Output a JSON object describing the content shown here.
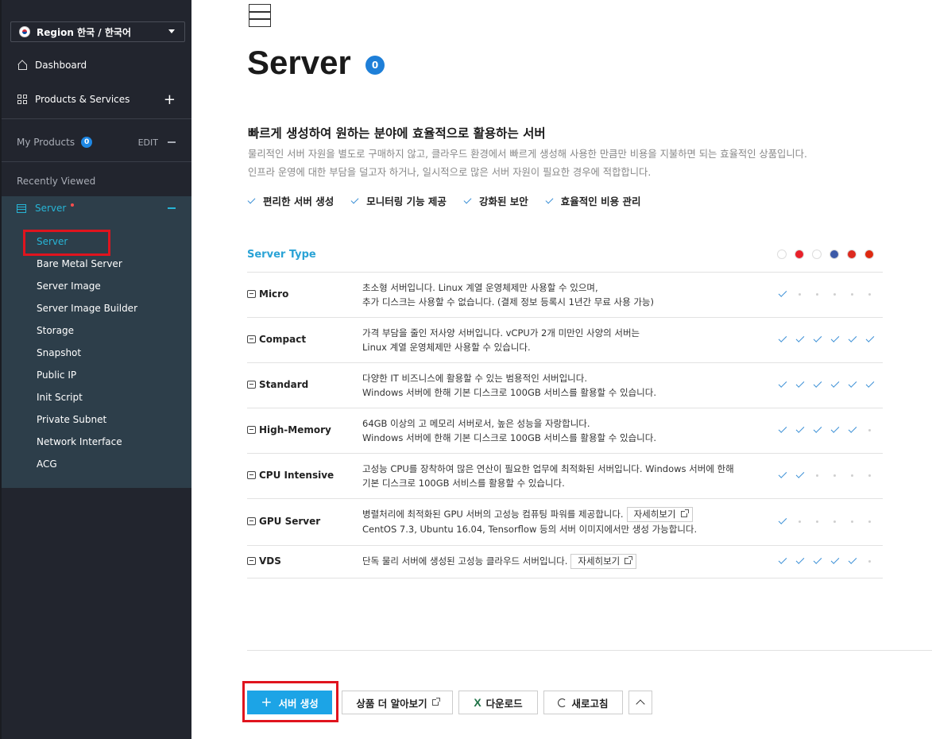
{
  "sidebar": {
    "region_label": "Region 한국 / 한국어",
    "dashboard": "Dashboard",
    "products_services": "Products & Services",
    "my_products": "My Products",
    "my_products_count": "0",
    "edit": "EDIT",
    "recently_viewed": "Recently Viewed",
    "group": "Server",
    "items": [
      "Server",
      "Bare Metal Server",
      "Server Image",
      "Server Image Builder",
      "Storage",
      "Snapshot",
      "Public IP",
      "Init Script",
      "Private Subnet",
      "Network Interface",
      "ACG"
    ],
    "accent": "#27b5d6"
  },
  "main": {
    "title": "Server",
    "count": "0",
    "headline": "빠르게 생성하여 원하는 분야에 효율적으로 활용하는 서버",
    "desc1": "물리적인 서버 자원을 별도로 구매하지 않고, 클라우드 환경에서 빠르게 생성해 사용한 만큼만 비용을 지불하면 되는 효율적인 상품입니다.",
    "desc2": "인프라 운영에 대한 부담을 덜고자 하거나, 일시적으로 많은 서버 자원이 필요한 경우에 적합합니다.",
    "features": [
      "편리한 서버 생성",
      "모니터링 기능 제공",
      "강화된 보안",
      "효율적인 비용 관리"
    ],
    "server_type_header": "Server Type",
    "types": [
      {
        "name": "Micro",
        "line1": "초소형 서버입니다. Linux 계열 운영체제만 사용할 수 있으며,",
        "line2": "추가 디스크는 사용할 수 없습니다. (결제 정보 등록시 1년간 무료 사용 가능)",
        "avail": [
          1,
          0,
          0,
          0,
          0,
          0
        ]
      },
      {
        "name": "Compact",
        "line1": "가격 부담을 줄인 저사양 서버입니다. vCPU가 2개 미만인 사양의 서버는",
        "line2": "Linux 계열 운영체제만 사용할 수 있습니다.",
        "avail": [
          1,
          1,
          1,
          1,
          1,
          1
        ]
      },
      {
        "name": "Standard",
        "line1": "다양한 IT 비즈니스에 활용할 수 있는 범용적인 서버입니다.",
        "line2": "Windows 서버에 한해 기본 디스크로 100GB 서비스를 활용할 수 있습니다.",
        "avail": [
          1,
          1,
          1,
          1,
          1,
          1
        ]
      },
      {
        "name": "High-Memory",
        "line1": "64GB 이상의 고 메모리 서버로서, 높은 성능을 자랑합니다.",
        "line2": "Windows 서버에 한해 기본 디스크로 100GB 서비스를 활용할 수 있습니다.",
        "avail": [
          1,
          1,
          1,
          1,
          1,
          0
        ]
      },
      {
        "name": "CPU Intensive",
        "line1": "고성능 CPU를 장착하여 많은 연산이 필요한 업무에 최적화된 서버입니다. Windows 서버에 한해",
        "line2": "기본 디스크로 100GB 서비스를 활용할 수 있습니다.",
        "avail": [
          1,
          1,
          0,
          0,
          0,
          0
        ]
      },
      {
        "name": "GPU Server",
        "line1": "병렬처리에 최적화된 GPU 서버의 고성능 컴퓨팅 파워를 제공합니다.",
        "line2": "CentOS 7.3, Ubuntu 16.04, Tensorflow 등의 서버 이미지에서만 생성 가능합니다.",
        "detail": "자세히보기",
        "avail": [
          1,
          0,
          0,
          0,
          0,
          0
        ]
      },
      {
        "name": "VDS",
        "line1": "단독 물리 서버에 생성된 고성능 클라우드 서버입니다.",
        "line2": "",
        "detail": "자세히보기",
        "avail": [
          1,
          1,
          1,
          1,
          1,
          0
        ]
      }
    ],
    "flags": [
      {
        "name": "korea-flag-icon",
        "color": "#ffffff"
      },
      {
        "name": "singapore-flag-icon",
        "color": "#e8202a"
      },
      {
        "name": "japan-flag-icon",
        "color": "#ffffff"
      },
      {
        "name": "usa-flag-icon",
        "color": "#3c5aa8"
      },
      {
        "name": "germany-flag-icon",
        "color": "#dd2a1f"
      },
      {
        "name": "hongkong-flag-icon",
        "color": "#de2910"
      }
    ]
  },
  "footer": {
    "create": "서버 생성",
    "learn_more": "상품 더 알아보기",
    "download": "다운로드",
    "refresh": "새로고침"
  }
}
